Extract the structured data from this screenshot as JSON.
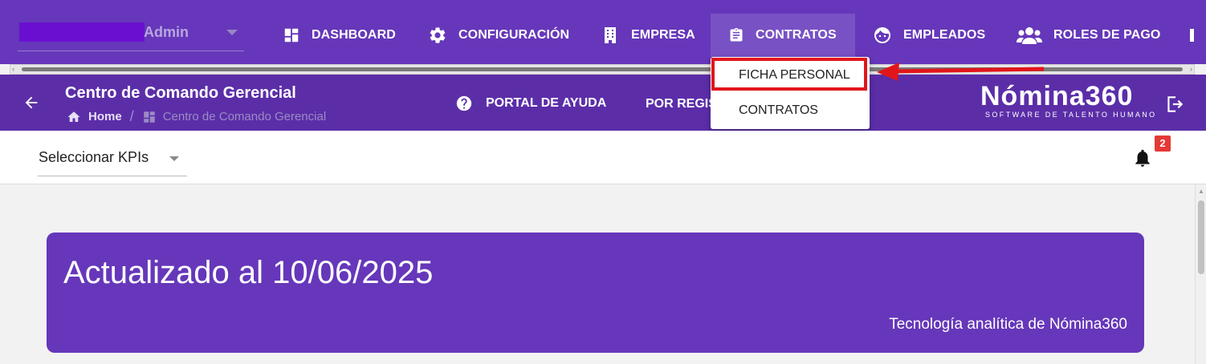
{
  "header": {
    "user": {
      "name": "Admin"
    },
    "nav": [
      {
        "label": "DASHBOARD",
        "icon": "dashboard-icon"
      },
      {
        "label": "CONFIGURACIÓN",
        "icon": "gear-icon"
      },
      {
        "label": "EMPRESA",
        "icon": "building-icon"
      },
      {
        "label": "CONTRATOS",
        "icon": "clipboard-icon",
        "active": true
      },
      {
        "label": "EMPLEADOS",
        "icon": "face-icon"
      },
      {
        "label": "ROLES DE PAGO",
        "icon": "people-icon"
      }
    ]
  },
  "dropdown": {
    "items": [
      "FICHA PERSONAL",
      "CONTRATOS"
    ]
  },
  "subheader": {
    "title": "Centro de Comando Gerencial",
    "breadcrumb": {
      "home": "Home",
      "current": "Centro de Comando Gerencial"
    },
    "help": "PORTAL DE AYUDA",
    "por_registrar": "POR REGISTRAR",
    "brand": {
      "name": "Nómina360",
      "tagline": "SOFTWARE DE TALENTO HUMANO"
    }
  },
  "kpi": {
    "select_label": "Seleccionar KPIs",
    "notifications_count": "2"
  },
  "banner": {
    "title": "Actualizado al 10/06/2025",
    "subtitle": "Tecnología analítica de Nómina360"
  },
  "colors": {
    "primary": "#6637ba",
    "primary_dark": "#5b2ea8",
    "highlight": "#e1161b",
    "badge": "#e53935"
  }
}
